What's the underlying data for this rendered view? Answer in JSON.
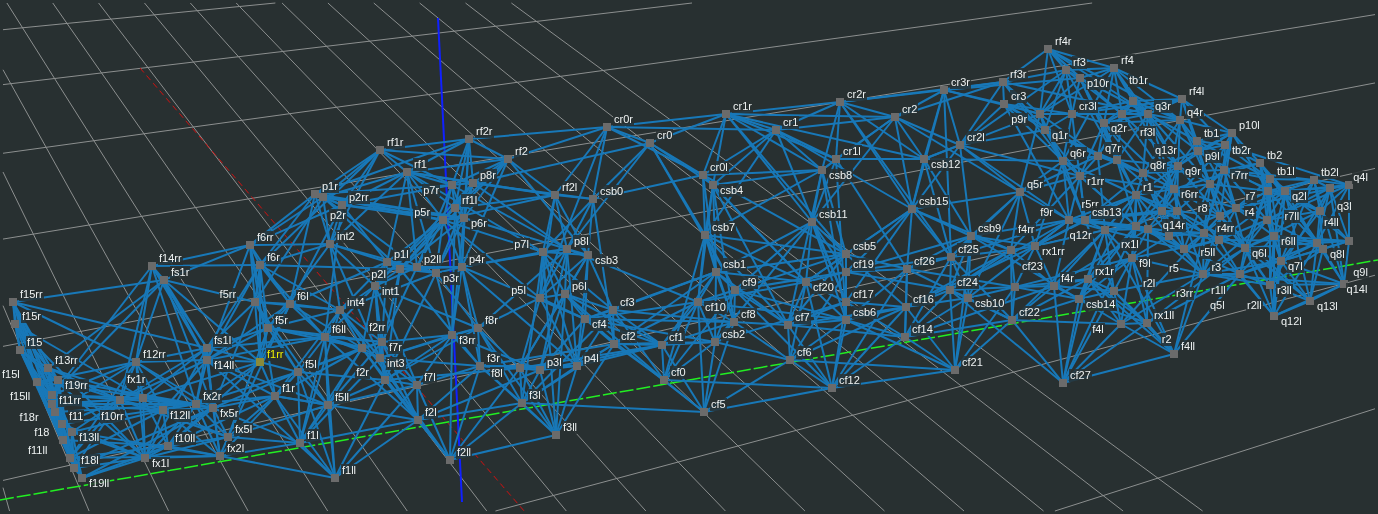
{
  "viewport": {
    "nodes": [
      {
        "label": "f15rr",
        "selected": false
      },
      {
        "label": "f15r",
        "selected": false
      },
      {
        "label": "f15",
        "selected": false
      },
      {
        "label": "f13rr",
        "selected": false
      },
      {
        "label": "f15l",
        "selected": false
      },
      {
        "label": "f19rr",
        "selected": false
      },
      {
        "label": "f11rr",
        "selected": false
      },
      {
        "label": "f15ll",
        "selected": false
      },
      {
        "label": "f18r",
        "selected": false
      },
      {
        "label": "f11",
        "selected": false
      },
      {
        "label": "f13ll",
        "selected": false
      },
      {
        "label": "f18",
        "selected": false
      },
      {
        "label": "f11ll",
        "selected": false
      },
      {
        "label": "f18l",
        "selected": false
      },
      {
        "label": "f19ll",
        "selected": false
      },
      {
        "label": "f14rr",
        "selected": false
      },
      {
        "label": "fs1r",
        "selected": false
      },
      {
        "label": "f12rr",
        "selected": false
      },
      {
        "label": "fx1r",
        "selected": false
      },
      {
        "label": "f10rr",
        "selected": false
      },
      {
        "label": "f12ll",
        "selected": false
      },
      {
        "label": "fx2r",
        "selected": false
      },
      {
        "label": "fx5r",
        "selected": false
      },
      {
        "label": "f10ll",
        "selected": false
      },
      {
        "label": "fx1l",
        "selected": false
      },
      {
        "label": "fx5l",
        "selected": false
      },
      {
        "label": "fx2l",
        "selected": false
      },
      {
        "label": "fs1l",
        "selected": false
      },
      {
        "label": "f14ll",
        "selected": false
      },
      {
        "label": "f1rr",
        "selected": true
      },
      {
        "label": "f6rr",
        "selected": false
      },
      {
        "label": "f6r",
        "selected": false
      },
      {
        "label": "f5rr",
        "selected": false
      },
      {
        "label": "f6l",
        "selected": false
      },
      {
        "label": "f5r",
        "selected": false
      },
      {
        "label": "f6ll",
        "selected": false
      },
      {
        "label": "f5l",
        "selected": false
      },
      {
        "label": "f1r",
        "selected": false
      },
      {
        "label": "f5ll",
        "selected": false
      },
      {
        "label": "f1l",
        "selected": false
      },
      {
        "label": "int2",
        "selected": false
      },
      {
        "label": "f1ll",
        "selected": false
      },
      {
        "label": "int1",
        "selected": false
      },
      {
        "label": "int4",
        "selected": false
      },
      {
        "label": "f2rr",
        "selected": false
      },
      {
        "label": "f7r",
        "selected": false
      },
      {
        "label": "int3",
        "selected": false
      },
      {
        "label": "f2r",
        "selected": false
      },
      {
        "label": "f7l",
        "selected": false
      },
      {
        "label": "f2l",
        "selected": false
      },
      {
        "label": "f2ll",
        "selected": false
      },
      {
        "label": "p1l",
        "selected": false
      },
      {
        "label": "p2l",
        "selected": false
      },
      {
        "label": "p2ll",
        "selected": false
      },
      {
        "label": "p3r",
        "selected": false
      },
      {
        "label": "p4r",
        "selected": false
      },
      {
        "label": "rf1r",
        "selected": false
      },
      {
        "label": "rf2r",
        "selected": false
      },
      {
        "label": "rf2",
        "selected": false
      },
      {
        "label": "rf1",
        "selected": false
      },
      {
        "label": "p7r",
        "selected": false
      },
      {
        "label": "p8r",
        "selected": false
      },
      {
        "label": "p1r",
        "selected": false
      },
      {
        "label": "p2r",
        "selected": false
      },
      {
        "label": "p2rr",
        "selected": false
      },
      {
        "label": "rf1l",
        "selected": false
      },
      {
        "label": "p5r",
        "selected": false
      },
      {
        "label": "p6r",
        "selected": false
      },
      {
        "label": "rf2l",
        "selected": false
      },
      {
        "label": "csb0",
        "selected": false
      },
      {
        "label": "cr0r",
        "selected": false
      },
      {
        "label": "cr0",
        "selected": false
      },
      {
        "label": "p7l",
        "selected": false
      },
      {
        "label": "p8l",
        "selected": false
      },
      {
        "label": "csb3",
        "selected": false
      },
      {
        "label": "p5l",
        "selected": false
      },
      {
        "label": "p6l",
        "selected": false
      },
      {
        "label": "cf4",
        "selected": false
      },
      {
        "label": "cf3",
        "selected": false
      },
      {
        "label": "f3rr",
        "selected": false
      },
      {
        "label": "f8r",
        "selected": false
      },
      {
        "label": "f3r",
        "selected": false
      },
      {
        "label": "f8l",
        "selected": false
      },
      {
        "label": "p3l",
        "selected": false
      },
      {
        "label": "p4l",
        "selected": false
      },
      {
        "label": "cf2",
        "selected": false
      },
      {
        "label": "cf1",
        "selected": false
      },
      {
        "label": "cf0",
        "selected": false
      },
      {
        "label": "f3l",
        "selected": false
      },
      {
        "label": "f3ll",
        "selected": false
      },
      {
        "label": "cf5",
        "selected": false
      },
      {
        "label": "cf12",
        "selected": false
      },
      {
        "label": "cf6",
        "selected": false
      },
      {
        "label": "csb2",
        "selected": false
      },
      {
        "label": "cf8",
        "selected": false
      },
      {
        "label": "cf7",
        "selected": false
      },
      {
        "label": "cf10",
        "selected": false
      },
      {
        "label": "cf9",
        "selected": false
      },
      {
        "label": "csb1",
        "selected": false
      },
      {
        "label": "csb7",
        "selected": false
      },
      {
        "label": "cf20",
        "selected": false
      },
      {
        "label": "csb5",
        "selected": false
      },
      {
        "label": "cf19",
        "selected": false
      },
      {
        "label": "cf17",
        "selected": false
      },
      {
        "label": "csb6",
        "selected": false
      },
      {
        "label": "cr1r",
        "selected": false
      },
      {
        "label": "cr1",
        "selected": false
      },
      {
        "label": "cr2r",
        "selected": false
      },
      {
        "label": "cr2",
        "selected": false
      },
      {
        "label": "cr3r",
        "selected": false
      },
      {
        "label": "rf3r",
        "selected": false
      },
      {
        "label": "cr3",
        "selected": false
      },
      {
        "label": "cr2l",
        "selected": false
      },
      {
        "label": "csb12",
        "selected": false
      },
      {
        "label": "cr1l",
        "selected": false
      },
      {
        "label": "csb8",
        "selected": false
      },
      {
        "label": "cr0l",
        "selected": false
      },
      {
        "label": "csb4",
        "selected": false
      },
      {
        "label": "csb11",
        "selected": false
      },
      {
        "label": "csb15",
        "selected": false
      },
      {
        "label": "csb9",
        "selected": false
      },
      {
        "label": "cf26",
        "selected": false
      },
      {
        "label": "cf25",
        "selected": false
      },
      {
        "label": "cf24",
        "selected": false
      },
      {
        "label": "csb10",
        "selected": false
      },
      {
        "label": "cf16",
        "selected": false
      },
      {
        "label": "cf14",
        "selected": false
      },
      {
        "label": "cf21",
        "selected": false
      },
      {
        "label": "cf22",
        "selected": false
      },
      {
        "label": "cf27",
        "selected": false
      },
      {
        "label": "f4rr",
        "selected": false
      },
      {
        "label": "cf23",
        "selected": false
      },
      {
        "label": "rx1rr",
        "selected": false
      },
      {
        "label": "f4r",
        "selected": false
      },
      {
        "label": "rx1r",
        "selected": false
      },
      {
        "label": "csb14",
        "selected": false
      },
      {
        "label": "rx1l",
        "selected": false
      },
      {
        "label": "f4l",
        "selected": false
      },
      {
        "label": "rx1ll",
        "selected": false
      },
      {
        "label": "f4ll",
        "selected": false
      },
      {
        "label": "f9l",
        "selected": false
      },
      {
        "label": "q5r",
        "selected": false
      },
      {
        "label": "rf4r",
        "selected": false
      },
      {
        "label": "rf3",
        "selected": false
      },
      {
        "label": "p9r",
        "selected": false
      },
      {
        "label": "p10r",
        "selected": false
      },
      {
        "label": "rf4",
        "selected": false
      },
      {
        "label": "cr3l",
        "selected": false
      },
      {
        "label": "q2r",
        "selected": false
      },
      {
        "label": "tb1r",
        "selected": false
      },
      {
        "label": "q3r",
        "selected": false
      },
      {
        "label": "rf3l",
        "selected": false
      },
      {
        "label": "rf4l",
        "selected": false
      },
      {
        "label": "q4r",
        "selected": false
      },
      {
        "label": "q1r",
        "selected": false
      },
      {
        "label": "q6r",
        "selected": false
      },
      {
        "label": "r1rr",
        "selected": false
      },
      {
        "label": "q7r",
        "selected": false
      },
      {
        "label": "r5rr",
        "selected": false
      },
      {
        "label": "q8r",
        "selected": false
      },
      {
        "label": "q9r",
        "selected": false
      },
      {
        "label": "r7rr",
        "selected": false
      },
      {
        "label": "tb1",
        "selected": false
      },
      {
        "label": "p9l",
        "selected": false
      },
      {
        "label": "tb2r",
        "selected": false
      },
      {
        "label": "p10l",
        "selected": false
      },
      {
        "label": "tb2",
        "selected": false
      },
      {
        "label": "tb1l",
        "selected": false
      },
      {
        "label": "r7",
        "selected": false
      },
      {
        "label": "q2l",
        "selected": false
      },
      {
        "label": "tb2l",
        "selected": false
      },
      {
        "label": "q3l",
        "selected": false
      },
      {
        "label": "q4l",
        "selected": false
      },
      {
        "label": "r7ll",
        "selected": false
      },
      {
        "label": "r1",
        "selected": false
      },
      {
        "label": "r6rr",
        "selected": false
      },
      {
        "label": "r4rr",
        "selected": false
      },
      {
        "label": "r8",
        "selected": false
      },
      {
        "label": "r5ll",
        "selected": false
      },
      {
        "label": "q14r",
        "selected": false
      },
      {
        "label": "r4",
        "selected": false
      },
      {
        "label": "r6ll",
        "selected": false
      },
      {
        "label": "r4ll",
        "selected": false
      },
      {
        "label": "q8l",
        "selected": false
      },
      {
        "label": "q9l",
        "selected": false
      },
      {
        "label": "f9r",
        "selected": false
      },
      {
        "label": "csb13",
        "selected": false
      },
      {
        "label": "q12r",
        "selected": false
      },
      {
        "label": "r2l",
        "selected": false
      },
      {
        "label": "q13r",
        "selected": false
      },
      {
        "label": "r5",
        "selected": false
      },
      {
        "label": "r3rr",
        "selected": false
      },
      {
        "label": "r2",
        "selected": false
      },
      {
        "label": "r3",
        "selected": false
      },
      {
        "label": "r1ll",
        "selected": false
      },
      {
        "label": "q6l",
        "selected": false
      },
      {
        "label": "r2ll",
        "selected": false
      },
      {
        "label": "q7l",
        "selected": false
      },
      {
        "label": "r3ll",
        "selected": false
      },
      {
        "label": "q5l",
        "selected": false
      },
      {
        "label": "q12l",
        "selected": false
      },
      {
        "label": "q13l",
        "selected": false
      },
      {
        "label": "q14l",
        "selected": false
      }
    ]
  }
}
